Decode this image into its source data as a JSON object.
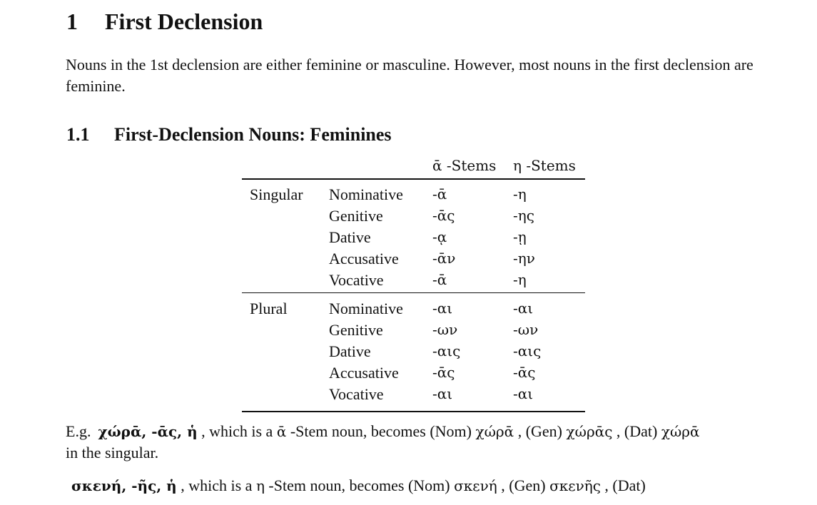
{
  "section": {
    "number": "1",
    "title": "First Declension"
  },
  "intro": "Nouns in the 1st declension are either feminine or masculine. However, most nouns in the first declension are feminine.",
  "subsection": {
    "number": "1.1",
    "title": "First-Declension Nouns: Feminines"
  },
  "table": {
    "headers": [
      "ᾱ -Stems",
      "η -Stems"
    ],
    "singular": {
      "label": "Singular",
      "rows": [
        [
          "Nominative",
          "-ᾱ",
          "-η"
        ],
        [
          "Genitive",
          "-ᾱς",
          "-ης"
        ],
        [
          "Dative",
          "-ᾳ",
          "-ῃ"
        ],
        [
          "Accusative",
          "-ᾱν",
          "-ην"
        ],
        [
          "Vocative",
          "-ᾱ",
          "-η"
        ]
      ]
    },
    "plural": {
      "label": "Plural",
      "rows": [
        [
          "Nominative",
          "-αι",
          "-αι"
        ],
        [
          "Genitive",
          "-ων",
          "-ων"
        ],
        [
          "Dative",
          "-αις",
          "-αις"
        ],
        [
          "Accusative",
          "-ᾱς",
          "-ᾱς"
        ],
        [
          "Vocative",
          "-αι",
          "-αι"
        ]
      ]
    }
  },
  "example1": {
    "prefix": "E.g.",
    "lemma": "χώρᾱ, -ᾱς, ἡ",
    "t1": ", which is a",
    "stem": "ᾱ",
    "t2": "-Stem noun, becomes (Nom)",
    "nom": "χώρᾱ",
    "t3": ", (Gen)",
    "gen": "χώρᾱς",
    "t4": ", (Dat)",
    "dat": "χώρᾱ",
    "t5": "in the singular."
  },
  "example2": {
    "lemma": "σκενή, -ῆς, ἡ",
    "t1": ", which is a",
    "stem": "η",
    "t2": "-Stem noun, becomes (Nom)",
    "nom": "σκενή",
    "t3": ", (Gen)",
    "gen": "σκενῆς",
    "t4": ", (Dat)"
  }
}
